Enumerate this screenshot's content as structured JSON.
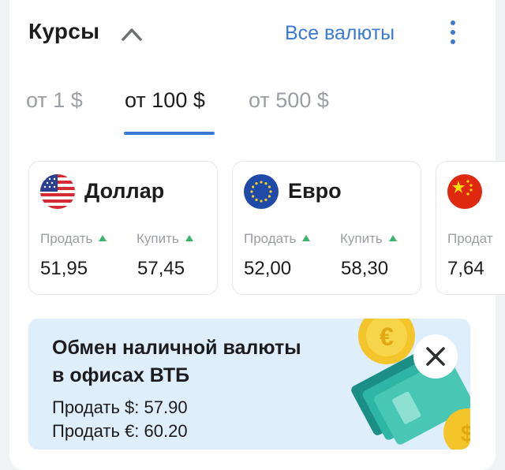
{
  "header": {
    "title": "Курсы",
    "all_currencies": "Все валюты"
  },
  "tabs": [
    {
      "label": "от 1 $",
      "active": false
    },
    {
      "label": "от 100 $",
      "active": true
    },
    {
      "label": "от 500 $",
      "active": false
    }
  ],
  "cards": [
    {
      "name": "Доллар",
      "flag": "us-flag",
      "sell_label": "Продать",
      "buy_label": "Купить",
      "sell": "51,95",
      "buy": "57,45"
    },
    {
      "name": "Евро",
      "flag": "eu-flag",
      "sell_label": "Продать",
      "buy_label": "Купить",
      "sell": "52,00",
      "buy": "58,30"
    },
    {
      "name": "",
      "flag": "cn-flag",
      "sell_label": "Продат",
      "sell": "7,64"
    }
  ],
  "promo": {
    "title_line1": "Обмен наличной валюты",
    "title_line2": "в офисах ВТБ",
    "line1": "Продать $: 57.90",
    "line2": "Продать €: 60.20"
  },
  "colors": {
    "accent": "#3a7ad3",
    "up": "#3bb36b",
    "promo_bg": "#deeefb"
  }
}
